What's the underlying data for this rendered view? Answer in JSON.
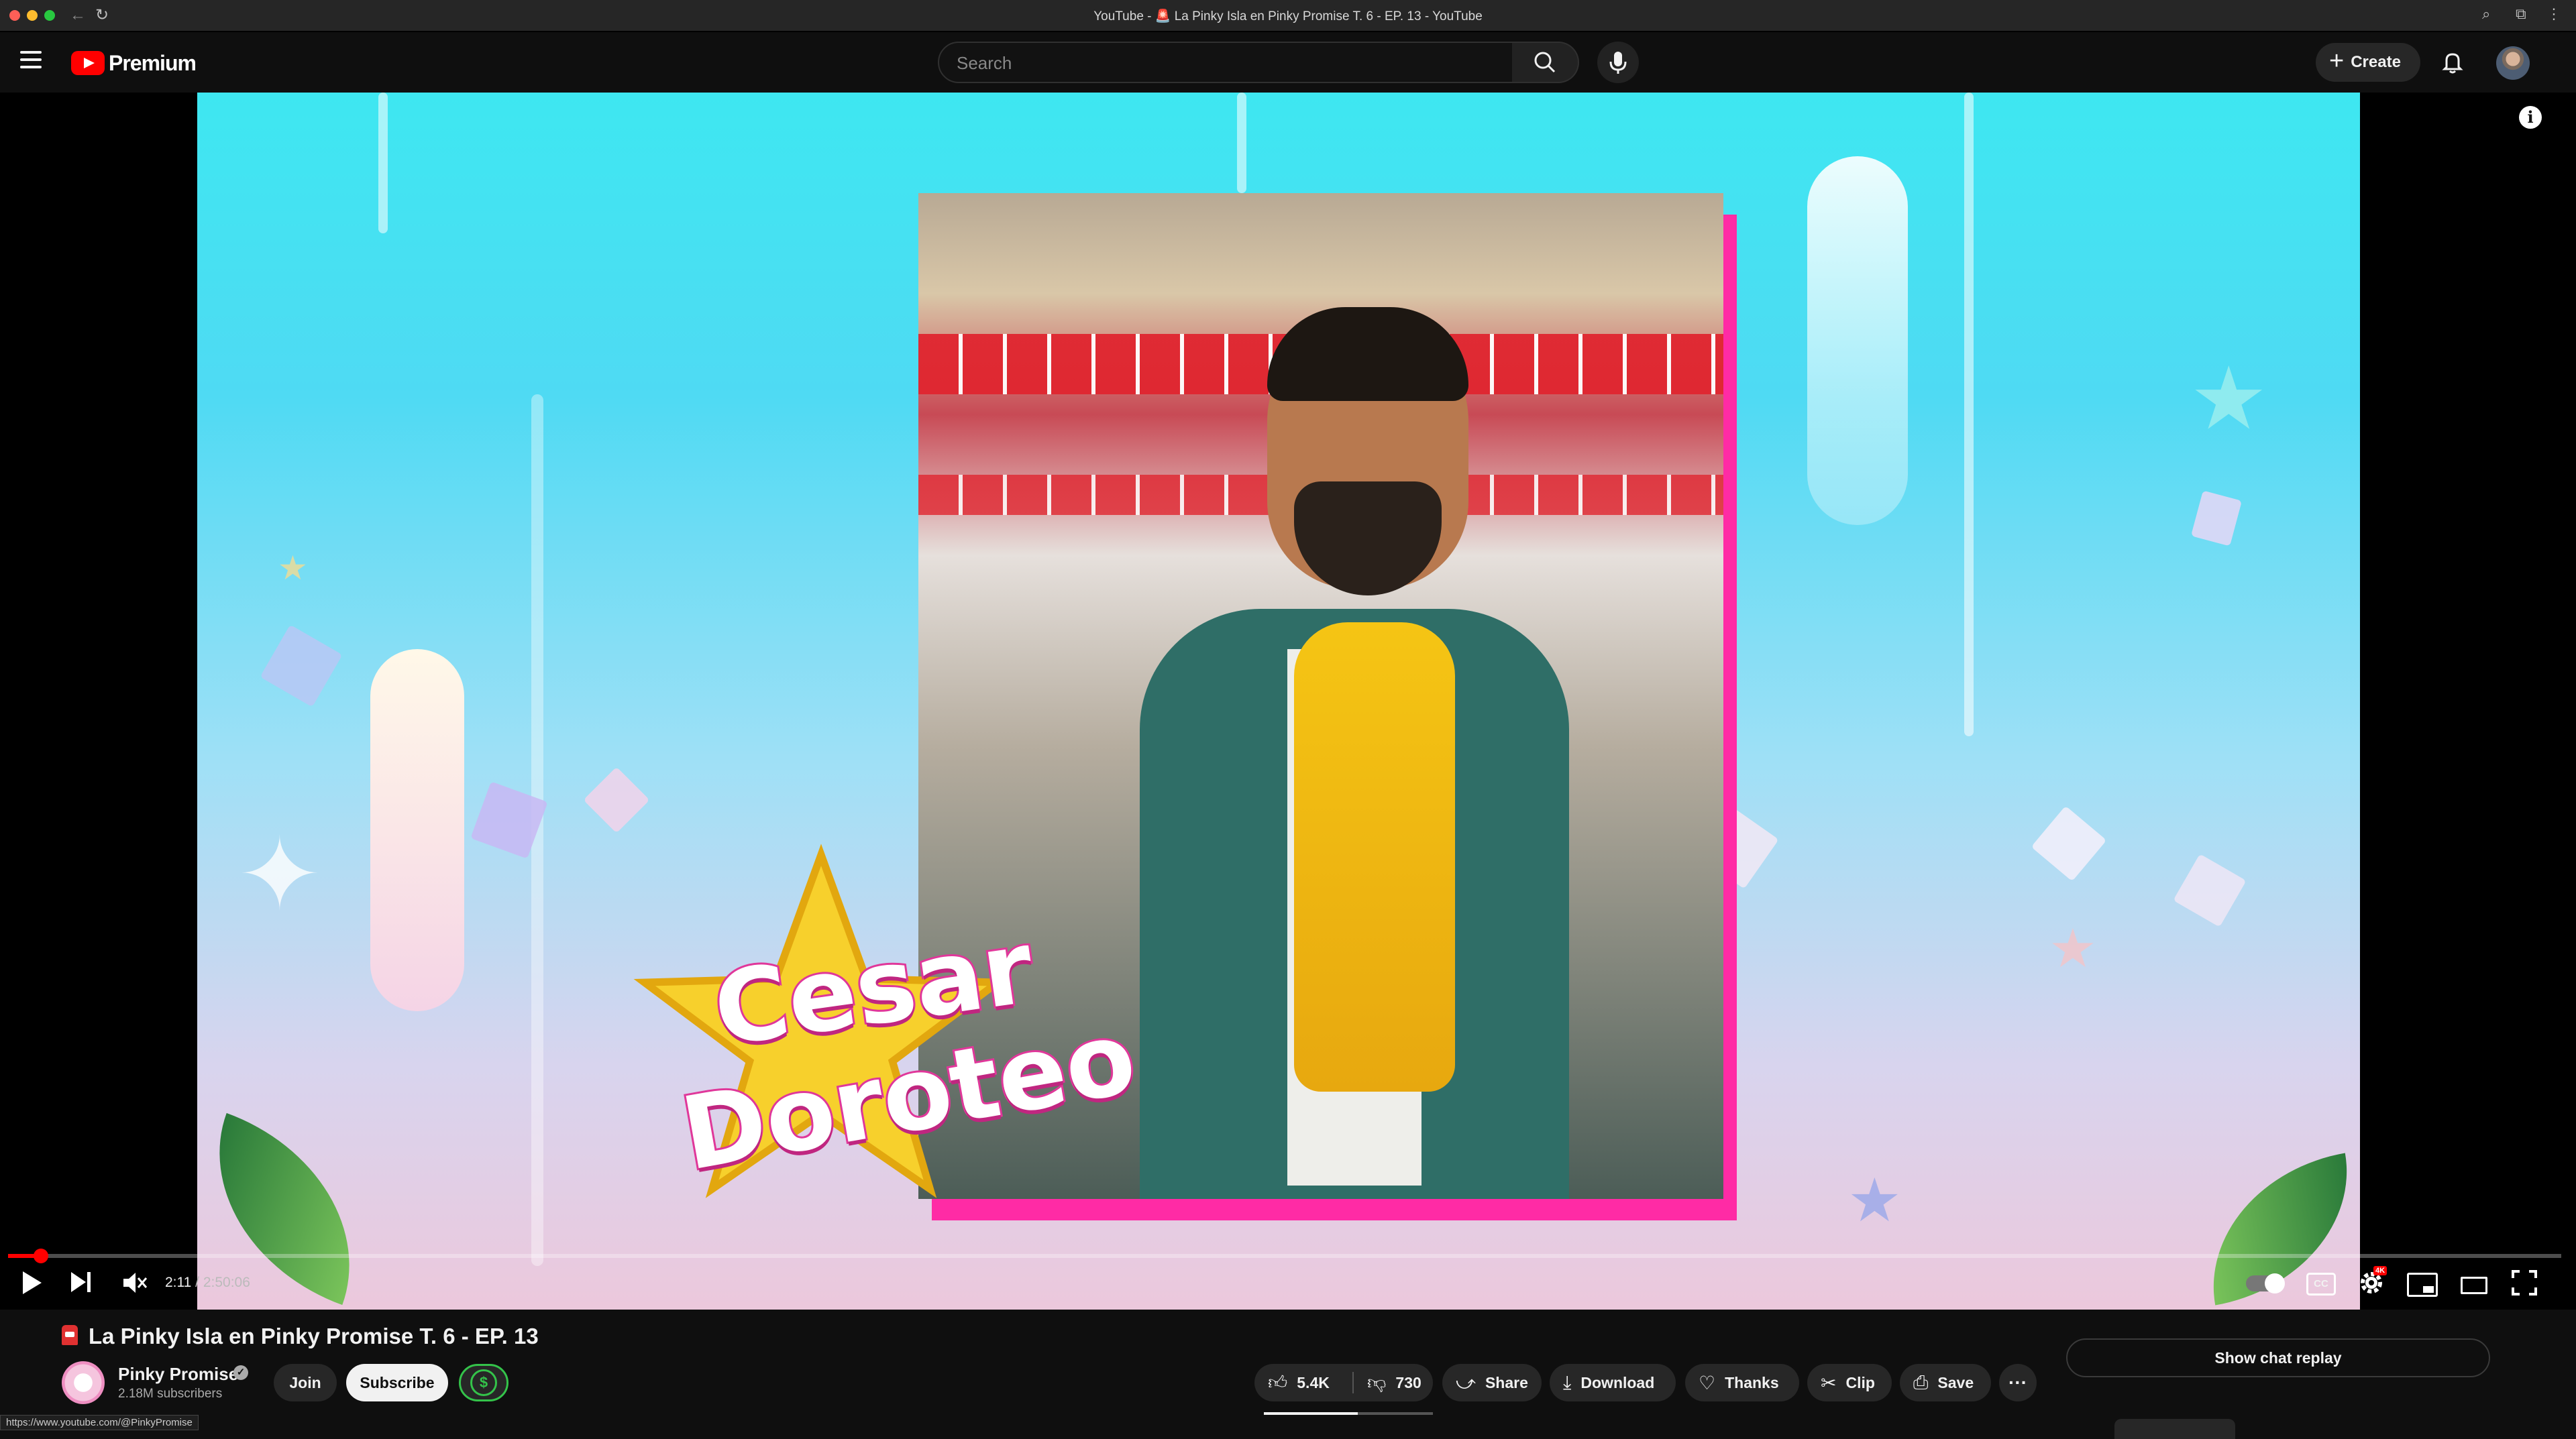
{
  "browser": {
    "window_title": "YouTube - 🚨 La Pinky Isla en Pinky Promise T. 6 - EP. 13 - YouTube",
    "back_icon": "arrow-left",
    "reload_icon": "reload"
  },
  "header": {
    "logo_text": "Premium",
    "search_placeholder": "Search",
    "create_label": "Create",
    "icons": [
      "menu-icon",
      "search-icon",
      "mic-icon",
      "bell-icon",
      "avatar"
    ]
  },
  "video": {
    "overlay_name_first": "Cesar",
    "overlay_name_last": "Doroteo",
    "info_icon_label": "i"
  },
  "player": {
    "current_time": "2:11",
    "separator": " / ",
    "duration": "2:50:06",
    "progress_fraction": 0.0128,
    "accent_color": "#ff0000",
    "cc_label": "CC",
    "hd_badge": "4K"
  },
  "below": {
    "title": "La Pinky Isla en Pinky Promise T. 6 - EP. 13",
    "channel_name": "Pinky Promise",
    "subscribers": "2.18M subscribers",
    "join_label": "Join",
    "subscribe_label": "Subscribe",
    "tip_icon_label": "$",
    "likes": "5.4K",
    "dislikes": "730",
    "share_label": "Share",
    "download_label": "Download",
    "thanks_label": "Thanks",
    "clip_label": "Clip",
    "save_label": "Save",
    "more_label": "···",
    "chat_replay_label": "Show chat replay"
  },
  "status_bar": {
    "url": "https://www.youtube.com/@PinkyPromise"
  }
}
